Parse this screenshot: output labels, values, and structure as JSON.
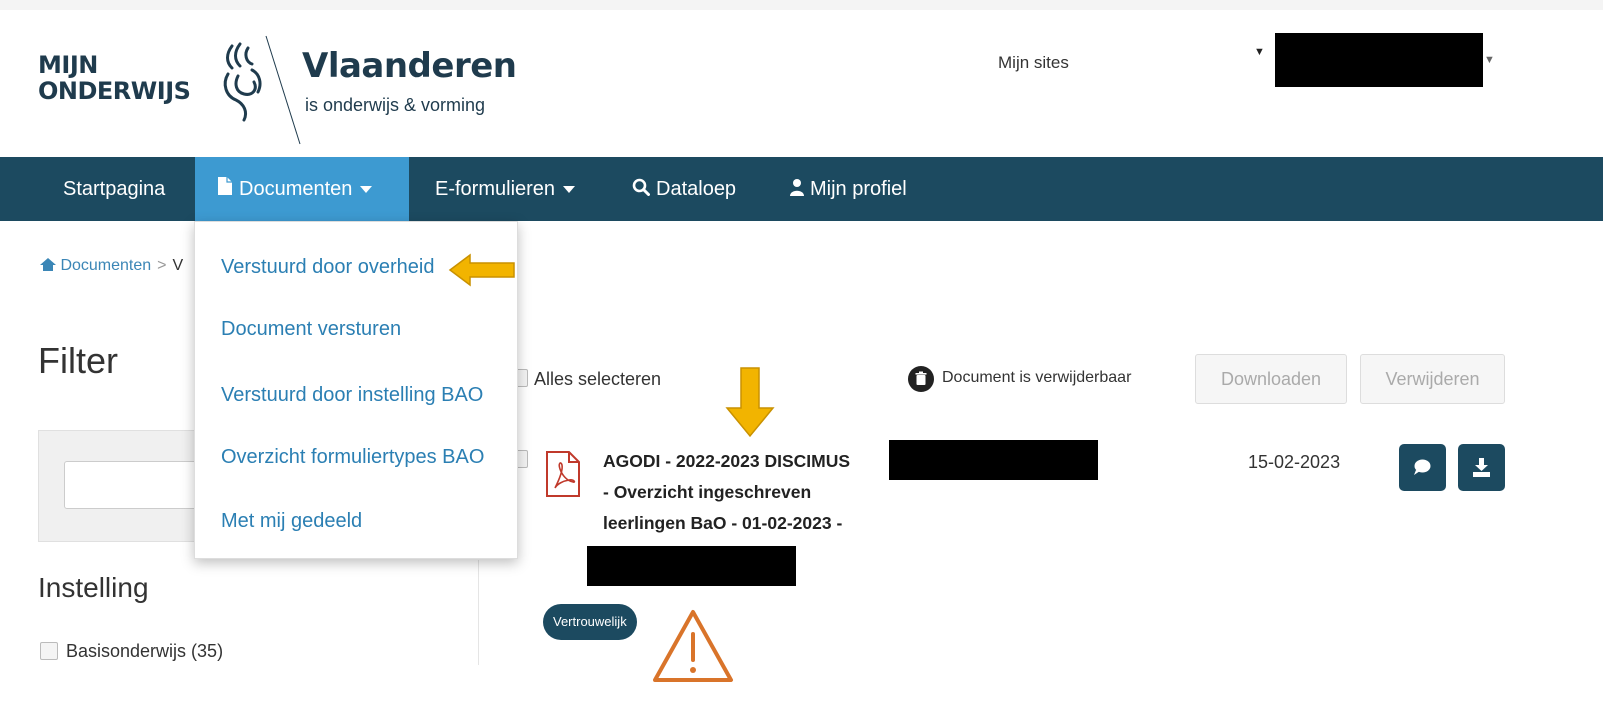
{
  "header": {
    "logo_line1": "MIJN",
    "logo_line2": "ONDERWIJS",
    "brand_title": "Vlaanderen",
    "brand_subtitle": "is onderwijs & vorming",
    "mijn_sites": "Mijn sites"
  },
  "nav": {
    "items": [
      {
        "label": "Startpagina",
        "icon": ""
      },
      {
        "label": "Documenten",
        "icon": "file-icon",
        "active": true,
        "has_caret": true
      },
      {
        "label": "E-formulieren",
        "icon": "",
        "has_caret": true
      },
      {
        "label": "Dataloep",
        "icon": "search-icon"
      },
      {
        "label": "Mijn profiel",
        "icon": "user-icon"
      }
    ]
  },
  "breadcrumb": {
    "home_icon": "home-icon",
    "root": "Documenten",
    "separator": ">",
    "current": "V"
  },
  "dropdown": {
    "items": [
      "Verstuurd door overheid",
      "Document versturen",
      "Verstuurd door instelling BAO",
      "Overzicht formuliertypes BAO",
      "Met mij gedeeld"
    ]
  },
  "filter": {
    "title": "Filter",
    "search_value": "",
    "instelling_title": "Instelling",
    "options": [
      {
        "label": "Basisonderwijs (35)",
        "checked": false
      }
    ]
  },
  "toolbar": {
    "select_all": "Alles selecteren",
    "legend_icon": "trash-icon",
    "legend_text": "Document is verwijderbaar",
    "download": "Downloaden",
    "delete": "Verwijderen"
  },
  "documents": [
    {
      "title_line1": "AGODI - 2022-2023 DISCIMUS",
      "title_line2": "- Overzicht ingeschreven",
      "title_line3": "leerlingen BaO - 01-02-2023 -",
      "date": "15-02-2023",
      "badge": "Vertrouwelijk",
      "file_icon": "pdf-icon",
      "action_icons": [
        "comment-icon",
        "download-icon"
      ]
    }
  ],
  "colors": {
    "nav_bg": "#1c4a60",
    "nav_active": "#3d9ad1",
    "link": "#2b7fb3",
    "annotation_arrow": "#f2b400",
    "warning": "#d9742a",
    "pdf_red": "#c0392b"
  }
}
